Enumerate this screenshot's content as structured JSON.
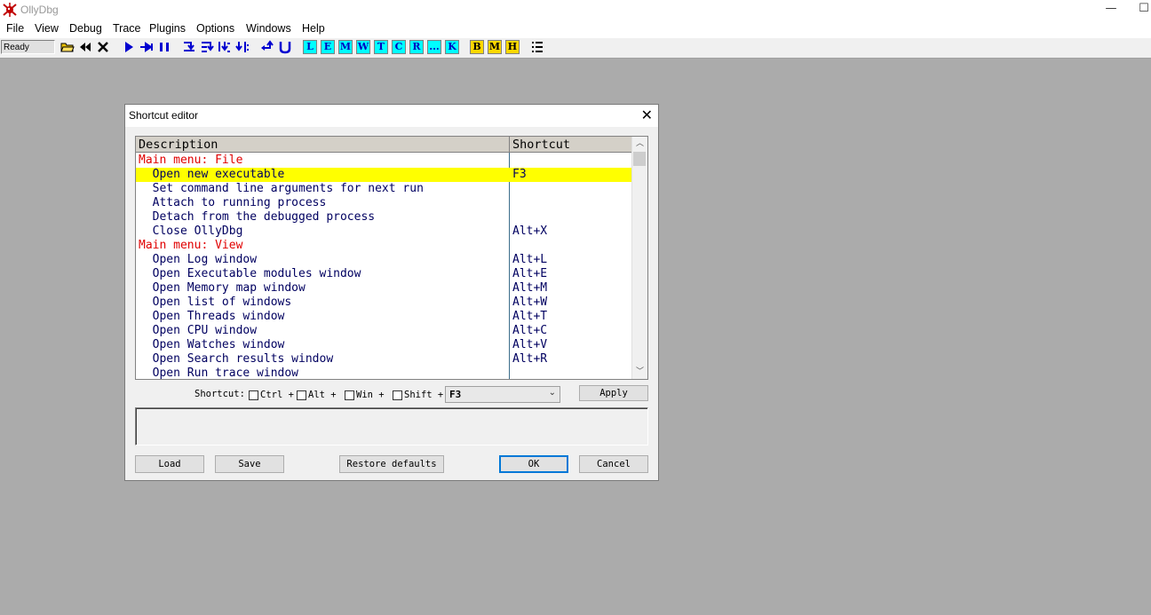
{
  "app": {
    "title": "OllyDbg",
    "minimize_glyph": "—",
    "maximize_glyph": "☐",
    "icon": "ollydbg-bug-icon"
  },
  "menubar": [
    "File",
    "View",
    "Debug",
    "Trace",
    "Plugins",
    "Options",
    "Windows",
    "Help"
  ],
  "toolbar": {
    "status": "Ready",
    "cyan_buttons": [
      "L",
      "E",
      "M",
      "W",
      "T",
      "C",
      "R",
      "...",
      "K"
    ],
    "yellow_buttons": [
      "B",
      "M",
      "H"
    ]
  },
  "dialog": {
    "title": "Shortcut editor",
    "close_glyph": "✕",
    "columns": [
      "Description",
      "Shortcut"
    ],
    "rows": [
      {
        "type": "group",
        "description": "Main menu: File",
        "shortcut": ""
      },
      {
        "type": "item",
        "description": "  Open new executable",
        "shortcut": "F3",
        "selected": true
      },
      {
        "type": "item",
        "description": "  Set command line arguments for next run",
        "shortcut": ""
      },
      {
        "type": "item",
        "description": "  Attach to running process",
        "shortcut": ""
      },
      {
        "type": "item",
        "description": "  Detach from the debugged process",
        "shortcut": ""
      },
      {
        "type": "item",
        "description": "  Close OllyDbg",
        "shortcut": "Alt+X"
      },
      {
        "type": "group",
        "description": "Main menu: View",
        "shortcut": ""
      },
      {
        "type": "item",
        "description": "  Open Log window",
        "shortcut": "Alt+L"
      },
      {
        "type": "item",
        "description": "  Open Executable modules window",
        "shortcut": "Alt+E"
      },
      {
        "type": "item",
        "description": "  Open Memory map window",
        "shortcut": "Alt+M"
      },
      {
        "type": "item",
        "description": "  Open list of windows",
        "shortcut": "Alt+W"
      },
      {
        "type": "item",
        "description": "  Open Threads window",
        "shortcut": "Alt+T"
      },
      {
        "type": "item",
        "description": "  Open CPU window",
        "shortcut": "Alt+C"
      },
      {
        "type": "item",
        "description": "  Open Watches window",
        "shortcut": "Alt+V"
      },
      {
        "type": "item",
        "description": "  Open Search results window",
        "shortcut": "Alt+R"
      },
      {
        "type": "item",
        "description": "  Open Run trace window",
        "shortcut": ""
      }
    ],
    "shortcut_label": "Shortcut:",
    "modifiers": [
      "Ctrl +",
      "Alt +",
      "Win +",
      "Shift +"
    ],
    "key_value": "F3",
    "apply_label": "Apply",
    "load_label": "Load",
    "save_label": "Save",
    "restore_label": "Restore defaults",
    "ok_label": "OK",
    "cancel_label": "Cancel",
    "scroll_up_glyph": "︿",
    "scroll_down_glyph": "﹀",
    "combo_arrow_glyph": "⌄"
  }
}
